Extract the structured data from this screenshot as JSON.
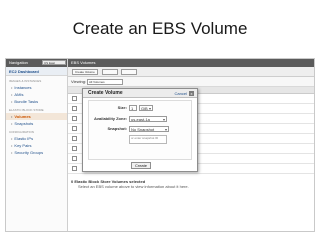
{
  "slide": {
    "title": "Create an EBS Volume"
  },
  "nav": {
    "header": "Navigation",
    "region": "US East",
    "dashboard": "EC2 Dashboard",
    "section_images": "IMAGES & INSTANCES",
    "items_top": [
      "Instances",
      "AMIs",
      "Bundle Tasks"
    ],
    "section_ebs": "ELASTIC BLOCK STORE",
    "items_ebs": [
      "Volumes",
      "Snapshots"
    ],
    "section_config": "CONFIGURATION",
    "items_config": [
      "Elastic IPs",
      "Key Pairs",
      "Security Groups"
    ]
  },
  "main": {
    "header": "EBS Volumes",
    "create_button": "Create Volume",
    "viewing_label": "Viewing:",
    "viewing_value": "All Volumes",
    "info_title": "0 Elastic Block Store Volumes selected",
    "info_text": "Select an EBS volume above to view information about it here."
  },
  "modal": {
    "title": "Create Volume",
    "cancel": "Cancel",
    "close": "x",
    "size_label": "Size:",
    "size_value": "1",
    "size_unit": "GiB",
    "zone_label": "Availability Zone:",
    "zone_value": "us-east-1a",
    "snapshot_label": "Snapshot:",
    "snapshot_value": "No Snapshot",
    "snapshot_hint": "or enter snapshot ID",
    "create_button": "Create"
  }
}
